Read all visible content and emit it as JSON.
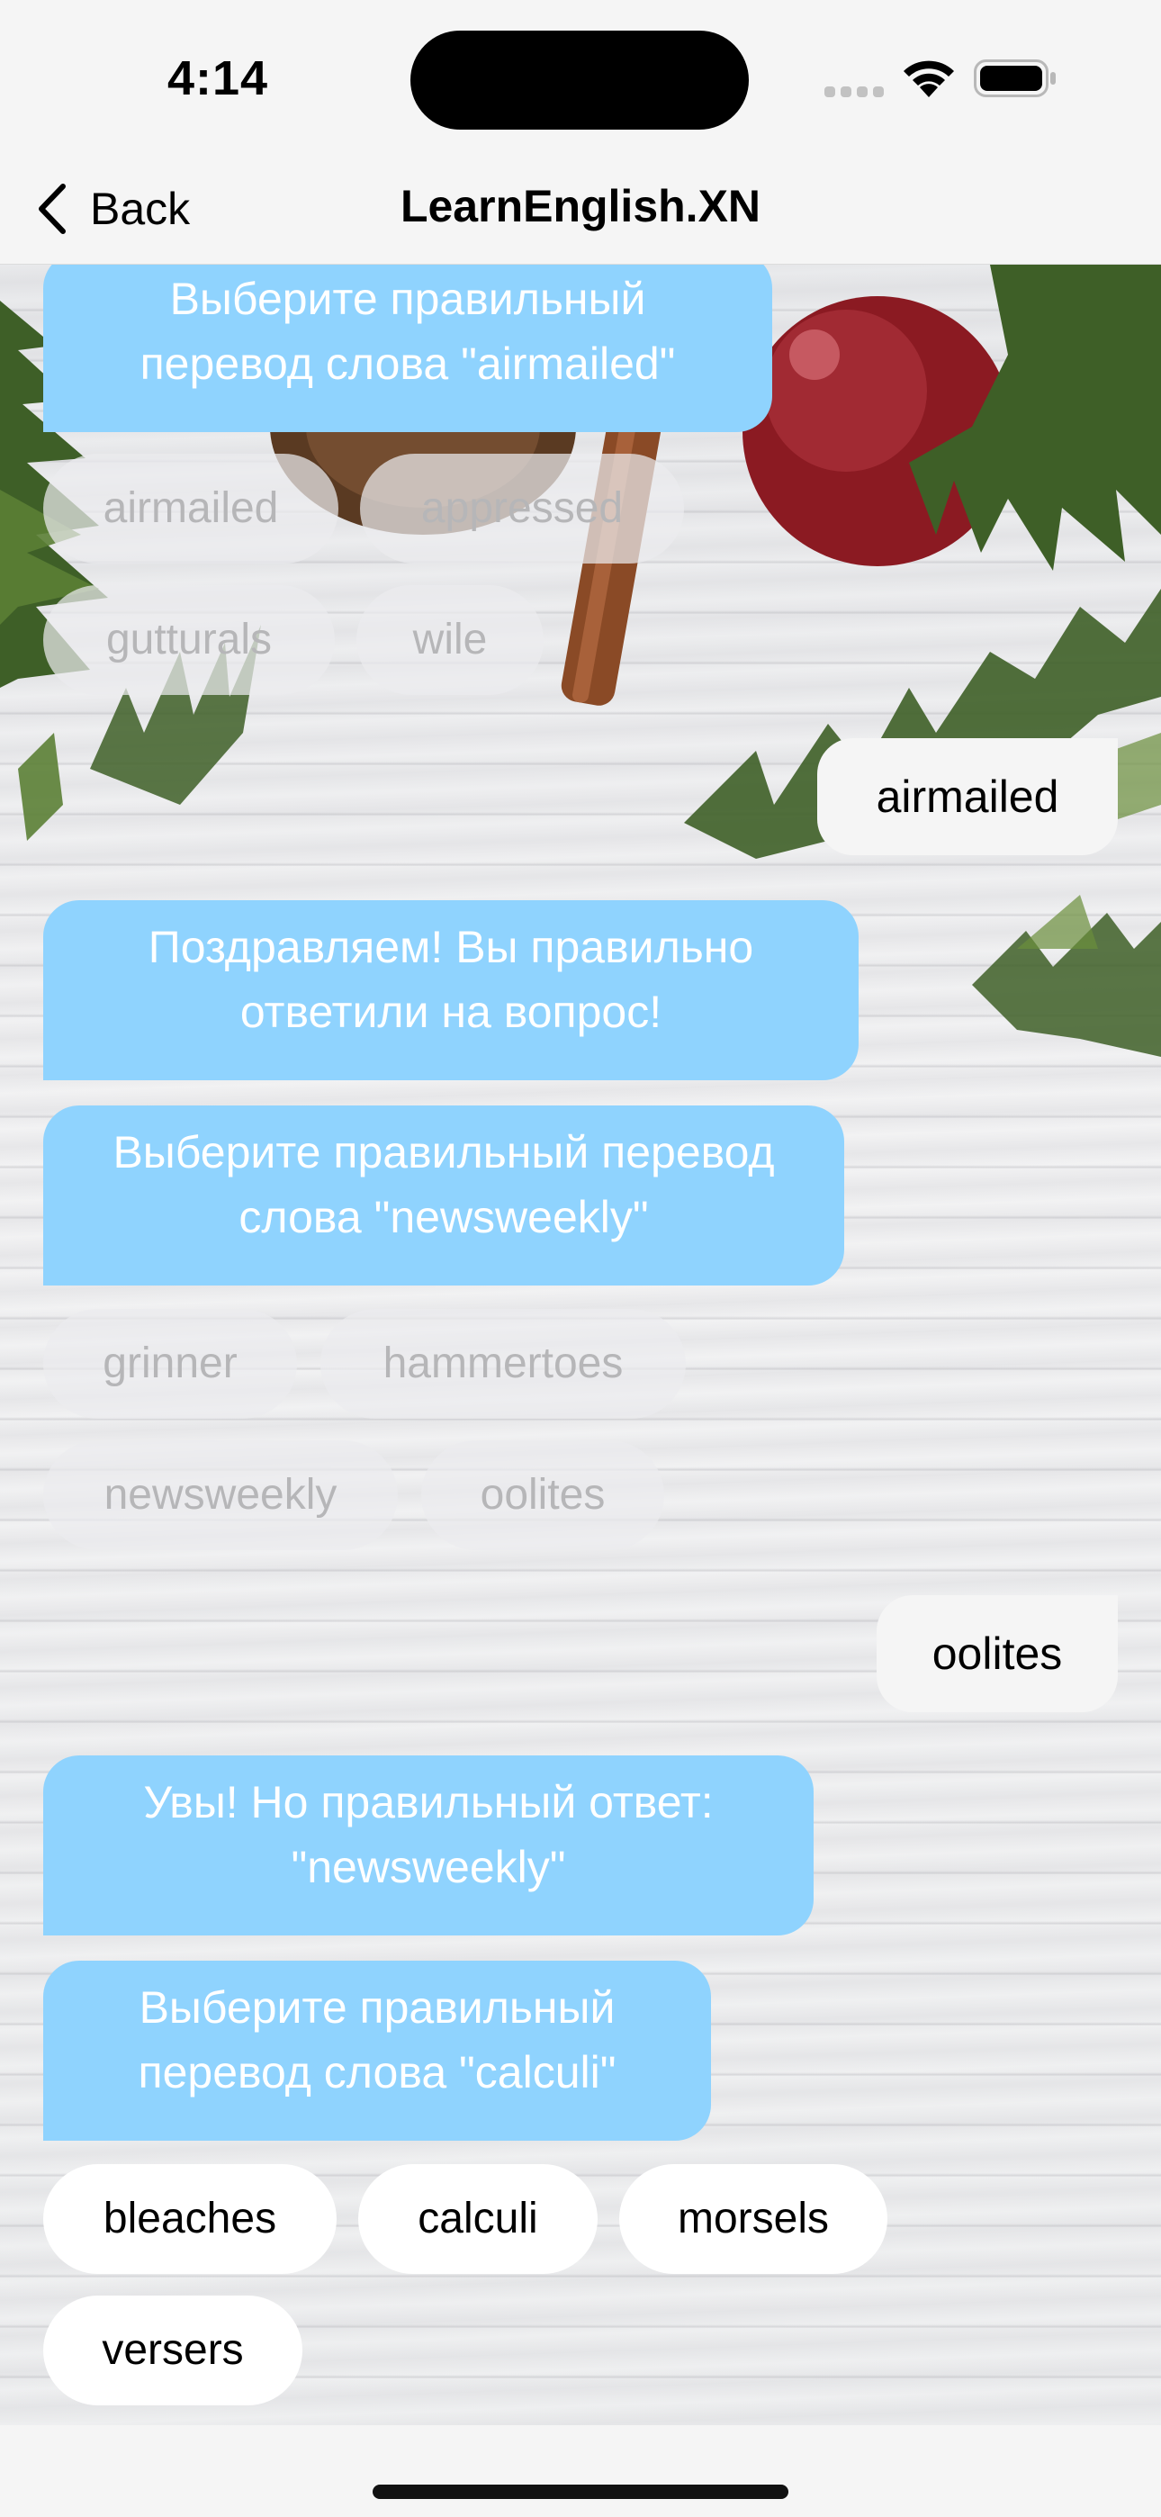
{
  "status_bar": {
    "time": "4:14",
    "icons": [
      "cellular-signal-icon",
      "wifi-icon",
      "battery-icon"
    ]
  },
  "nav": {
    "back_label": "Back",
    "title": "LearnEnglish.XN"
  },
  "colors": {
    "bot_bubble": "#8fd3fe",
    "user_bubble": "#f5f5f5",
    "active_option": "#ffffff"
  },
  "messages": [
    {
      "from": "bot",
      "text": "Выберите правильный перевод слова \"airmailed\""
    },
    {
      "from": "options",
      "state": "answered",
      "items": [
        "airmailed",
        "appressed",
        "gutturals",
        "wile"
      ]
    },
    {
      "from": "user",
      "text": "airmailed"
    },
    {
      "from": "bot",
      "text": "Поздравляем! Вы правильно ответили на вопрос!"
    },
    {
      "from": "bot",
      "text": "Выберите правильный перевод слова \"newsweekly\""
    },
    {
      "from": "options",
      "state": "answered",
      "items": [
        "grinner",
        "hammertoes",
        "newsweekly",
        "oolites"
      ]
    },
    {
      "from": "user",
      "text": "oolites"
    },
    {
      "from": "bot",
      "text": "Увы! Но правильный ответ: \"newsweekly\""
    },
    {
      "from": "bot",
      "text": "Выберите правильный перевод слова \"calculi\""
    },
    {
      "from": "options",
      "state": "active",
      "items": [
        "bleaches",
        "calculi",
        "morsels",
        "versers"
      ]
    }
  ]
}
